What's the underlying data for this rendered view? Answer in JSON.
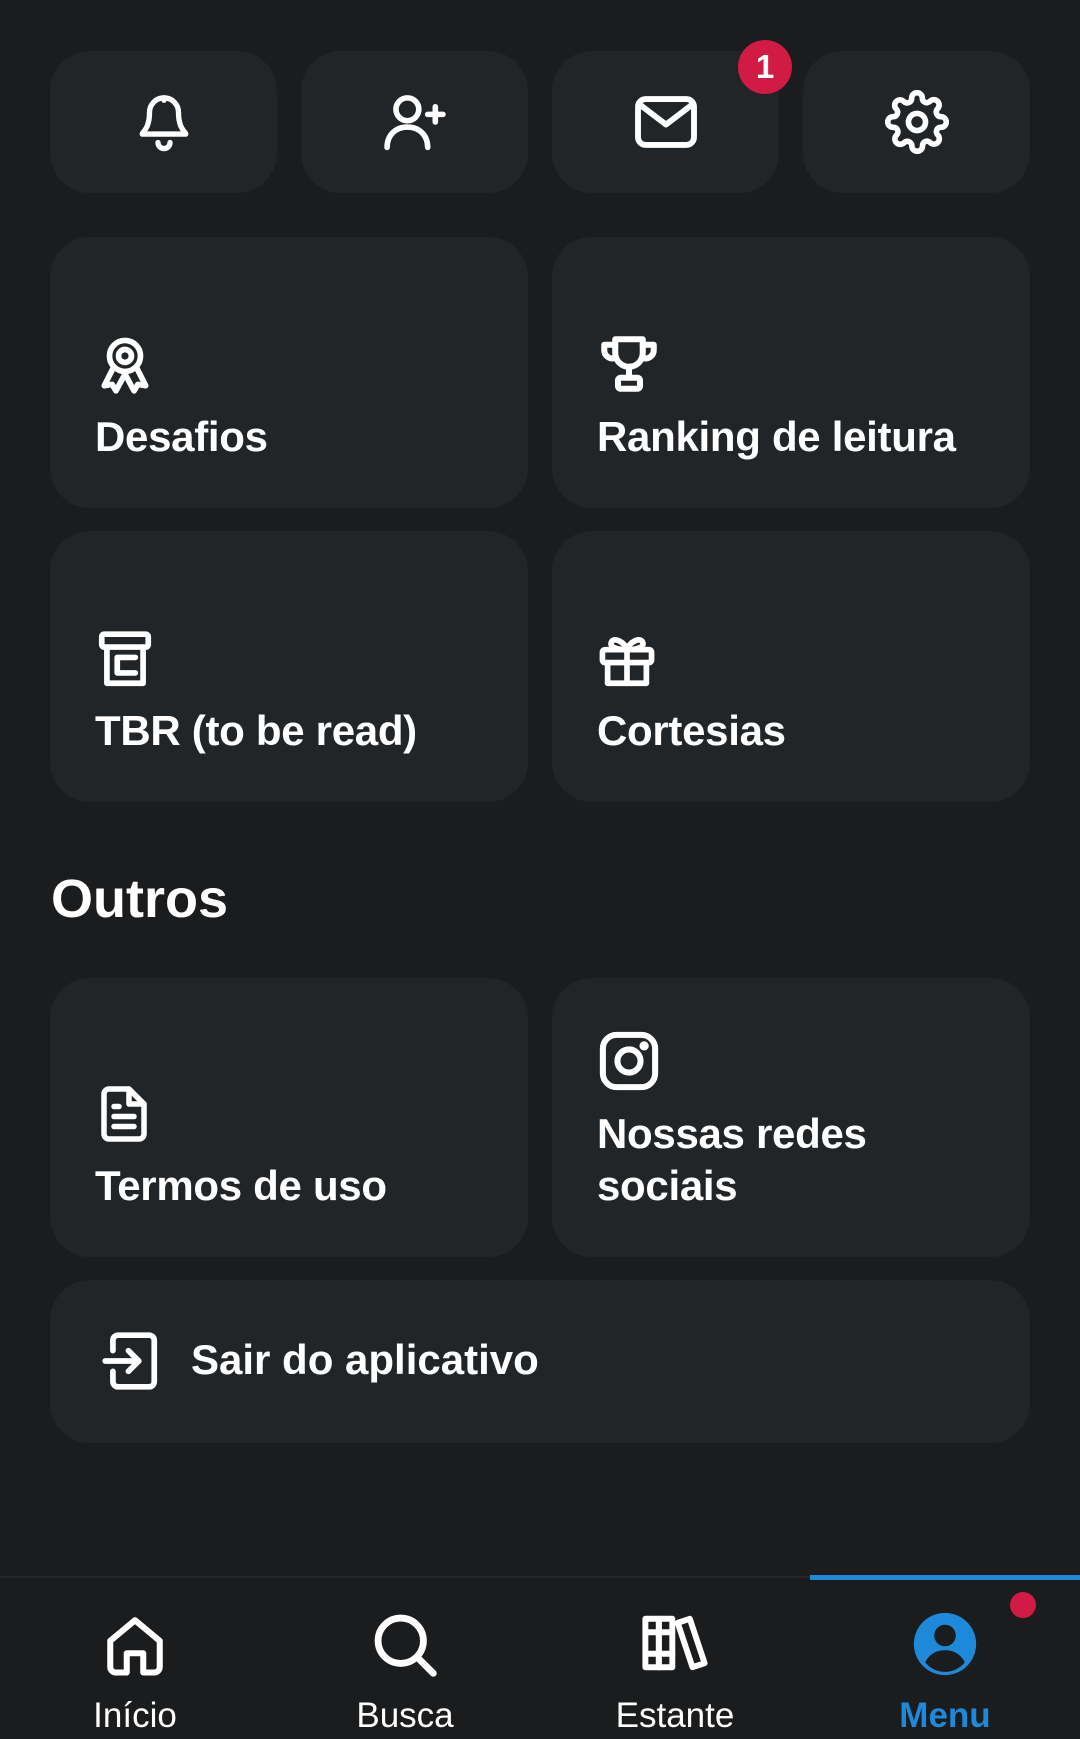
{
  "top_actions": [
    {
      "icon": "bell-icon"
    },
    {
      "icon": "user-plus-icon"
    },
    {
      "icon": "mail-icon",
      "badge": "1"
    },
    {
      "icon": "gear-icon"
    }
  ],
  "cards": [
    {
      "label": "Desafios",
      "icon": "award-icon"
    },
    {
      "label": "Ranking de leitura",
      "icon": "trophy-icon"
    },
    {
      "label": "TBR (to be read)",
      "icon": "bookmark-box-icon"
    },
    {
      "label": "Cortesias",
      "icon": "gift-icon"
    }
  ],
  "others": {
    "title": "Outros",
    "items": [
      {
        "label": "Termos de uso",
        "icon": "document-icon"
      },
      {
        "label_line1": "Nossas redes",
        "label_line2": "sociais",
        "icon": "instagram-icon"
      }
    ],
    "logout_label": "Sair do aplicativo"
  },
  "bottom_nav": [
    {
      "label": "Início",
      "icon": "home-icon"
    },
    {
      "label": "Busca",
      "icon": "search-icon"
    },
    {
      "label": "Estante",
      "icon": "bookshelf-icon"
    },
    {
      "label": "Menu",
      "icon": "user-circle-icon",
      "active": true
    }
  ],
  "colors": {
    "background": "#1b1c1d",
    "tile": "#222527",
    "accent": "#1e88d9",
    "badge": "#d11a44"
  }
}
